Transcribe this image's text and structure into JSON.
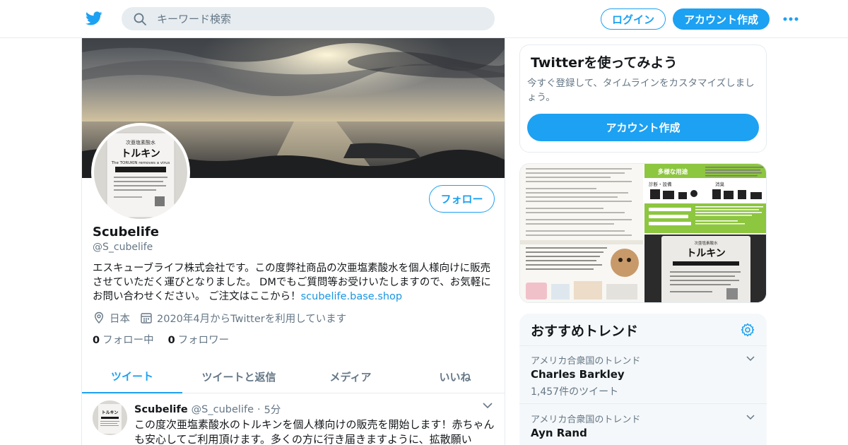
{
  "header": {
    "search_placeholder": "キーワード検索",
    "login_label": "ログイン",
    "signup_label": "アカウント作成",
    "brand_color": "#1da1f2"
  },
  "profile": {
    "follow_label": "フォロー",
    "name": "Scubelife",
    "handle": "@S_cubelife",
    "bio": "エスキューブライフ株式会社です。この度弊社商品の次亜塩素酸水を個人様向けに販売させていただく運びとなりました。 DMでもご質問等お受けいたしますので、お気軽にお問い合わせください。 ご注文はここから！",
    "bio_link": "scubelife.base.shop",
    "location": "日本",
    "joined": "2020年4月からTwitterを利用しています",
    "following_count": "0",
    "following_label": "フォロー中",
    "followers_count": "0",
    "followers_label": "フォロワー",
    "avatar_product_lines": [
      "次亜塩素酸水",
      "トルキン",
      "The TORUKIN removes a virus"
    ]
  },
  "tabs": [
    {
      "label": "ツイート",
      "active": true
    },
    {
      "label": "ツイートと返信",
      "active": false
    },
    {
      "label": "メディア",
      "active": false
    },
    {
      "label": "いいね",
      "active": false
    }
  ],
  "tweet": {
    "name": "Scubelife",
    "handle": "@S_cubelife",
    "separator": "·",
    "time": "5分",
    "text": "この度次亜塩素酸水のトルキンを個人様向けの販売を開始します！赤ちゃんも安心してご利用頂けます。多くの方に行き届きますように、拡散願い"
  },
  "sidebar": {
    "signup_title": "Twitterを使ってみよう",
    "signup_desc": "今すぐ登録して、タイムラインをカスタマイズしましょう。",
    "signup_button": "アカウント作成",
    "media_labels": {
      "tr_title": "多様な用途",
      "tr_sub1": "診断・設備",
      "tr_sub2": "消臭",
      "br_title": "トルキン"
    },
    "trends_title": "おすすめトレンド",
    "trends": [
      {
        "location": "アメリカ合衆国のトレンド",
        "topic": "Charles Barkley",
        "count": "1,457件のツイート"
      },
      {
        "location": "アメリカ合衆国のトレンド",
        "topic": "Ayn Rand",
        "count": ""
      }
    ]
  }
}
